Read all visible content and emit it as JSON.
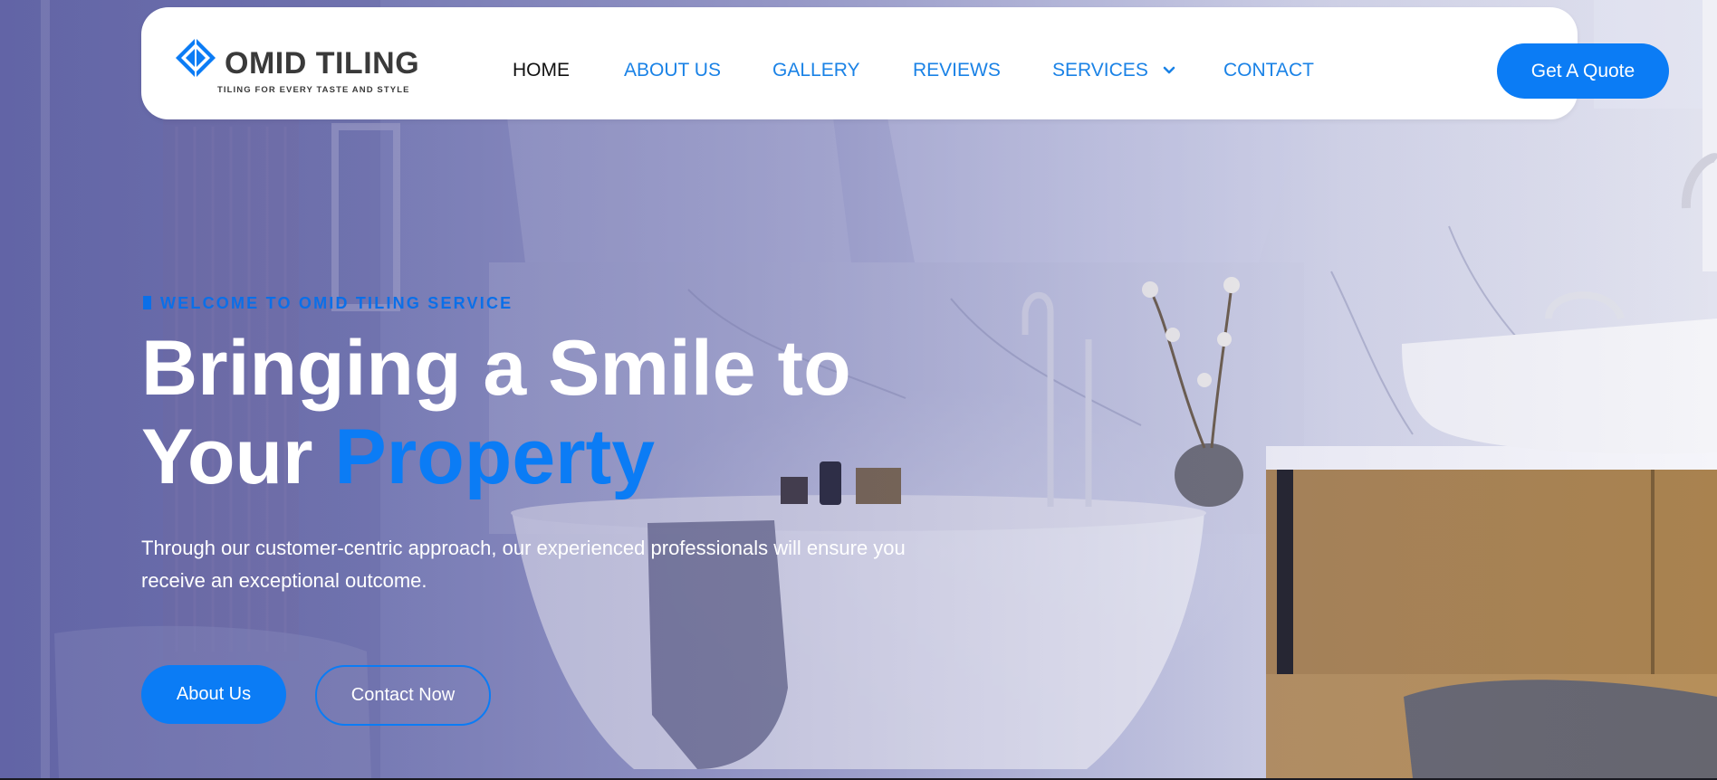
{
  "brand": {
    "name": "OMID TILING",
    "tagline": "TILING FOR EVERY TASTE AND STYLE"
  },
  "nav": {
    "home": "HOME",
    "about": "ABOUT US",
    "gallery": "GALLERY",
    "reviews": "REVIEWS",
    "services": "SERVICES",
    "contact": "CONTACT",
    "quote_button": "Get A Quote"
  },
  "hero": {
    "eyebrow": "WELCOME TO OMID TILING SERVICE",
    "headline_line1": "Bringing a Smile to",
    "headline_line2_prefix": "Your",
    "headline_accent": "Property",
    "lead": "Through our customer-centric approach, our experienced professionals will ensure you receive an exceptional outcome.",
    "primary_button": "About Us",
    "secondary_button": "Contact Now"
  },
  "icons": {
    "logo": "diamond-logo-icon",
    "services_dropdown": "chevron-down-icon"
  },
  "colors": {
    "accent": "#0b7cf5",
    "nav_active": "#111111",
    "nav_link": "#1a82e6",
    "logo_text": "#3a3a3a"
  }
}
